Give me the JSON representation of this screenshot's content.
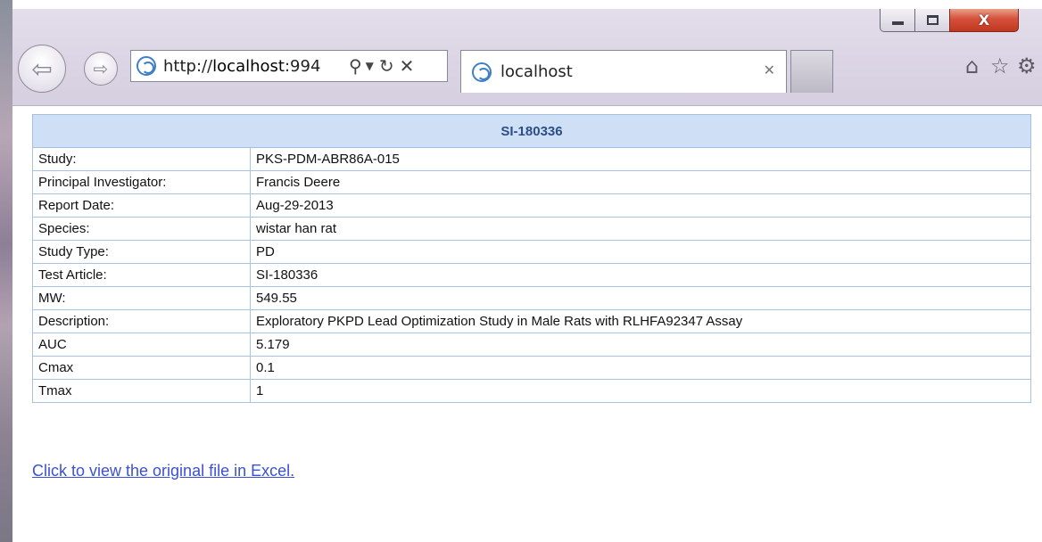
{
  "browser": {
    "url_prefix": "http://",
    "url_host": "localhost",
    "url_suffix": ":994",
    "tab_title": "localhost",
    "close_glyph": "X"
  },
  "report": {
    "title": "SI-180336",
    "rows": [
      {
        "label": "Study:",
        "value": "PKS-PDM-ABR86A-015"
      },
      {
        "label": "Principal Investigator:",
        "value": "Francis Deere"
      },
      {
        "label": "Report Date:",
        "value": "Aug-29-2013"
      },
      {
        "label": "Species:",
        "value": "wistar han rat"
      },
      {
        "label": "Study Type:",
        "value": "PD"
      },
      {
        "label": "Test Article:",
        "value": "SI-180336"
      },
      {
        "label": "MW:",
        "value": "549.55"
      },
      {
        "label": "Description:",
        "value": "Exploratory PKPD Lead Optimization Study in Male Rats with RLHFA92347 Assay"
      },
      {
        "label": "AUC",
        "value": "5.179"
      },
      {
        "label": "Cmax",
        "value": "0.1"
      },
      {
        "label": "Tmax",
        "value": "1"
      }
    ],
    "excel_link": "Click to view the original file in Excel."
  },
  "colors": {
    "header_bg": "#cfe0f6",
    "header_text": "#2b4e86",
    "border": "#a5bfe0",
    "link": "#3b51d6"
  },
  "icons": [
    "back-arrow-icon",
    "forward-arrow-icon",
    "ie-logo-icon",
    "search-icon",
    "dropdown-icon",
    "refresh-icon",
    "stop-icon",
    "tab-close-icon",
    "home-icon",
    "star-icon",
    "gear-icon"
  ]
}
